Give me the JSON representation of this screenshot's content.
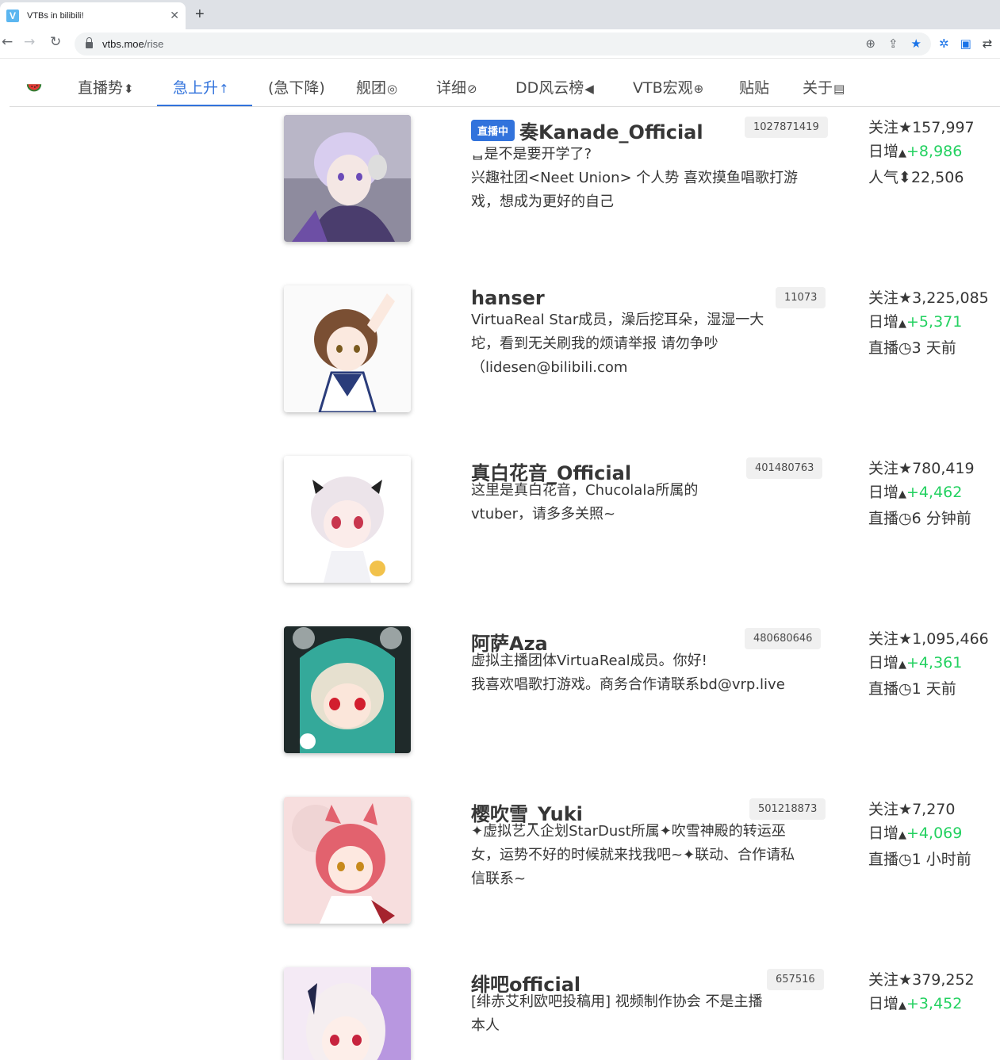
{
  "browser": {
    "tab_title": "VTBs in bilibili!",
    "tab_favicon": "V",
    "tab_close": "✕",
    "newtab": "+",
    "url_host": "vtbs.moe",
    "url_path": "/rise"
  },
  "nav": {
    "logo": "watermelon-icon",
    "items": [
      {
        "label": "直播势",
        "icon": "⬍"
      },
      {
        "label": "急上升",
        "icon": "↑"
      },
      {
        "label": "(急下降)",
        "icon": ""
      },
      {
        "label": "舰团",
        "icon": "◎"
      },
      {
        "label": "详细",
        "icon": "⊘"
      },
      {
        "label": "DD风云榜",
        "icon": "◀"
      },
      {
        "label": "VTB宏观",
        "icon": "⊕"
      },
      {
        "label": "贴贴",
        "icon": ""
      },
      {
        "label": "关于",
        "icon": "▤"
      }
    ],
    "active": "急上升"
  },
  "entries": [
    {
      "live": "直播中",
      "name": "奏Kanade_Official",
      "uid": "1027871419",
      "sign": "ᆸ是不是要开学了?\n兴趣社团<Neet Union> 个人势 喜欢摸鱼唱歌打游戏，想成为更好的自己",
      "follow_label": "关注",
      "follow": "157,997",
      "daily_label": "日增",
      "daily": "+8,986",
      "third_label": "人气",
      "third": "22,506",
      "third_icon": "⬍"
    },
    {
      "live": "",
      "name": "hanser",
      "uid": "11073",
      "sign": "VirtuaReal Star成员，澡后挖耳朵，湿湿一大坨，看到无关刷我的烦请举报 请勿争吵（lidesen@bilibili.com",
      "follow_label": "关注",
      "follow": "3,225,085",
      "daily_label": "日增",
      "daily": "+5,371",
      "third_label": "直播",
      "third": "3 天前",
      "third_icon": "◷"
    },
    {
      "live": "",
      "name": "真白花音_Official",
      "uid": "401480763",
      "sign": "这里是真白花音，Chucolala所属的vtuber，请多多关照~",
      "follow_label": "关注",
      "follow": "780,419",
      "daily_label": "日增",
      "daily": "+4,462",
      "third_label": "直播",
      "third": "6 分钟前",
      "third_icon": "◷"
    },
    {
      "live": "",
      "name": "阿萨Aza",
      "uid": "480680646",
      "sign": "虚拟主播团体VirtuaReal成员。你好!\n我喜欢唱歌打游戏。商务合作请联系bd@vrp.live",
      "follow_label": "关注",
      "follow": "1,095,466",
      "daily_label": "日增",
      "daily": "+4,361",
      "third_label": "直播",
      "third": "1 天前",
      "third_icon": "◷"
    },
    {
      "live": "",
      "name": "樱吹雪_Yuki",
      "uid": "501218873",
      "sign": "✦虚拟艺人企划StarDust所属✦吹雪神殿的转运巫女，运势不好的时候就来找我吧~✦联动、合作请私信联系~",
      "follow_label": "关注",
      "follow": "7,270",
      "daily_label": "日增",
      "daily": "+4,069",
      "third_label": "直播",
      "third": "1 小时前",
      "third_icon": "◷"
    },
    {
      "live": "",
      "name": "绯吧official",
      "uid": "657516",
      "sign": "[绯赤艾利欧吧投稿用] 视频制作协会 不是主播本人",
      "follow_label": "关注",
      "follow": "379,252",
      "daily_label": "日增",
      "daily": "+3,452",
      "third_label": "",
      "third": "",
      "third_icon": ""
    }
  ]
}
